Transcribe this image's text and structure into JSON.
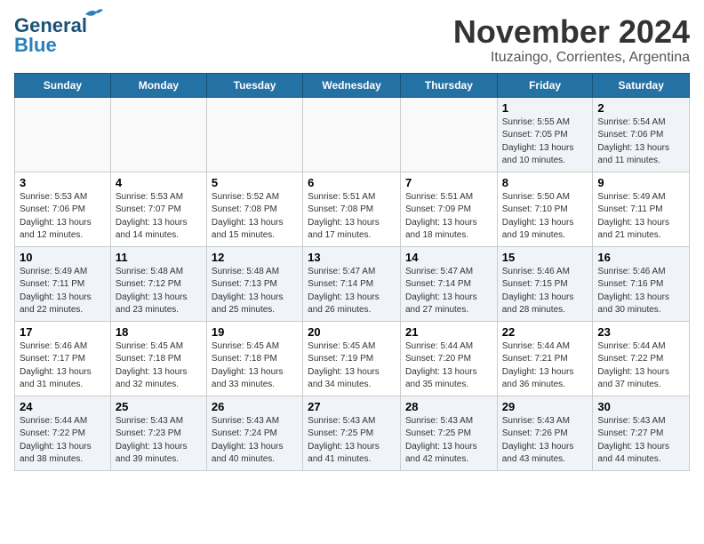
{
  "header": {
    "logo_general": "General",
    "logo_blue": "Blue",
    "month_title": "November 2024",
    "location": "Ituzaingo, Corrientes, Argentina"
  },
  "weekdays": [
    "Sunday",
    "Monday",
    "Tuesday",
    "Wednesday",
    "Thursday",
    "Friday",
    "Saturday"
  ],
  "rows": [
    {
      "cells": [
        {
          "day": "",
          "info": ""
        },
        {
          "day": "",
          "info": ""
        },
        {
          "day": "",
          "info": ""
        },
        {
          "day": "",
          "info": ""
        },
        {
          "day": "",
          "info": ""
        },
        {
          "day": "1",
          "info": "Sunrise: 5:55 AM\nSunset: 7:05 PM\nDaylight: 13 hours\nand 10 minutes."
        },
        {
          "day": "2",
          "info": "Sunrise: 5:54 AM\nSunset: 7:06 PM\nDaylight: 13 hours\nand 11 minutes."
        }
      ]
    },
    {
      "cells": [
        {
          "day": "3",
          "info": "Sunrise: 5:53 AM\nSunset: 7:06 PM\nDaylight: 13 hours\nand 12 minutes."
        },
        {
          "day": "4",
          "info": "Sunrise: 5:53 AM\nSunset: 7:07 PM\nDaylight: 13 hours\nand 14 minutes."
        },
        {
          "day": "5",
          "info": "Sunrise: 5:52 AM\nSunset: 7:08 PM\nDaylight: 13 hours\nand 15 minutes."
        },
        {
          "day": "6",
          "info": "Sunrise: 5:51 AM\nSunset: 7:08 PM\nDaylight: 13 hours\nand 17 minutes."
        },
        {
          "day": "7",
          "info": "Sunrise: 5:51 AM\nSunset: 7:09 PM\nDaylight: 13 hours\nand 18 minutes."
        },
        {
          "day": "8",
          "info": "Sunrise: 5:50 AM\nSunset: 7:10 PM\nDaylight: 13 hours\nand 19 minutes."
        },
        {
          "day": "9",
          "info": "Sunrise: 5:49 AM\nSunset: 7:11 PM\nDaylight: 13 hours\nand 21 minutes."
        }
      ]
    },
    {
      "cells": [
        {
          "day": "10",
          "info": "Sunrise: 5:49 AM\nSunset: 7:11 PM\nDaylight: 13 hours\nand 22 minutes."
        },
        {
          "day": "11",
          "info": "Sunrise: 5:48 AM\nSunset: 7:12 PM\nDaylight: 13 hours\nand 23 minutes."
        },
        {
          "day": "12",
          "info": "Sunrise: 5:48 AM\nSunset: 7:13 PM\nDaylight: 13 hours\nand 25 minutes."
        },
        {
          "day": "13",
          "info": "Sunrise: 5:47 AM\nSunset: 7:14 PM\nDaylight: 13 hours\nand 26 minutes."
        },
        {
          "day": "14",
          "info": "Sunrise: 5:47 AM\nSunset: 7:14 PM\nDaylight: 13 hours\nand 27 minutes."
        },
        {
          "day": "15",
          "info": "Sunrise: 5:46 AM\nSunset: 7:15 PM\nDaylight: 13 hours\nand 28 minutes."
        },
        {
          "day": "16",
          "info": "Sunrise: 5:46 AM\nSunset: 7:16 PM\nDaylight: 13 hours\nand 30 minutes."
        }
      ]
    },
    {
      "cells": [
        {
          "day": "17",
          "info": "Sunrise: 5:46 AM\nSunset: 7:17 PM\nDaylight: 13 hours\nand 31 minutes."
        },
        {
          "day": "18",
          "info": "Sunrise: 5:45 AM\nSunset: 7:18 PM\nDaylight: 13 hours\nand 32 minutes."
        },
        {
          "day": "19",
          "info": "Sunrise: 5:45 AM\nSunset: 7:18 PM\nDaylight: 13 hours\nand 33 minutes."
        },
        {
          "day": "20",
          "info": "Sunrise: 5:45 AM\nSunset: 7:19 PM\nDaylight: 13 hours\nand 34 minutes."
        },
        {
          "day": "21",
          "info": "Sunrise: 5:44 AM\nSunset: 7:20 PM\nDaylight: 13 hours\nand 35 minutes."
        },
        {
          "day": "22",
          "info": "Sunrise: 5:44 AM\nSunset: 7:21 PM\nDaylight: 13 hours\nand 36 minutes."
        },
        {
          "day": "23",
          "info": "Sunrise: 5:44 AM\nSunset: 7:22 PM\nDaylight: 13 hours\nand 37 minutes."
        }
      ]
    },
    {
      "cells": [
        {
          "day": "24",
          "info": "Sunrise: 5:44 AM\nSunset: 7:22 PM\nDaylight: 13 hours\nand 38 minutes."
        },
        {
          "day": "25",
          "info": "Sunrise: 5:43 AM\nSunset: 7:23 PM\nDaylight: 13 hours\nand 39 minutes."
        },
        {
          "day": "26",
          "info": "Sunrise: 5:43 AM\nSunset: 7:24 PM\nDaylight: 13 hours\nand 40 minutes."
        },
        {
          "day": "27",
          "info": "Sunrise: 5:43 AM\nSunset: 7:25 PM\nDaylight: 13 hours\nand 41 minutes."
        },
        {
          "day": "28",
          "info": "Sunrise: 5:43 AM\nSunset: 7:25 PM\nDaylight: 13 hours\nand 42 minutes."
        },
        {
          "day": "29",
          "info": "Sunrise: 5:43 AM\nSunset: 7:26 PM\nDaylight: 13 hours\nand 43 minutes."
        },
        {
          "day": "30",
          "info": "Sunrise: 5:43 AM\nSunset: 7:27 PM\nDaylight: 13 hours\nand 44 minutes."
        }
      ]
    }
  ]
}
